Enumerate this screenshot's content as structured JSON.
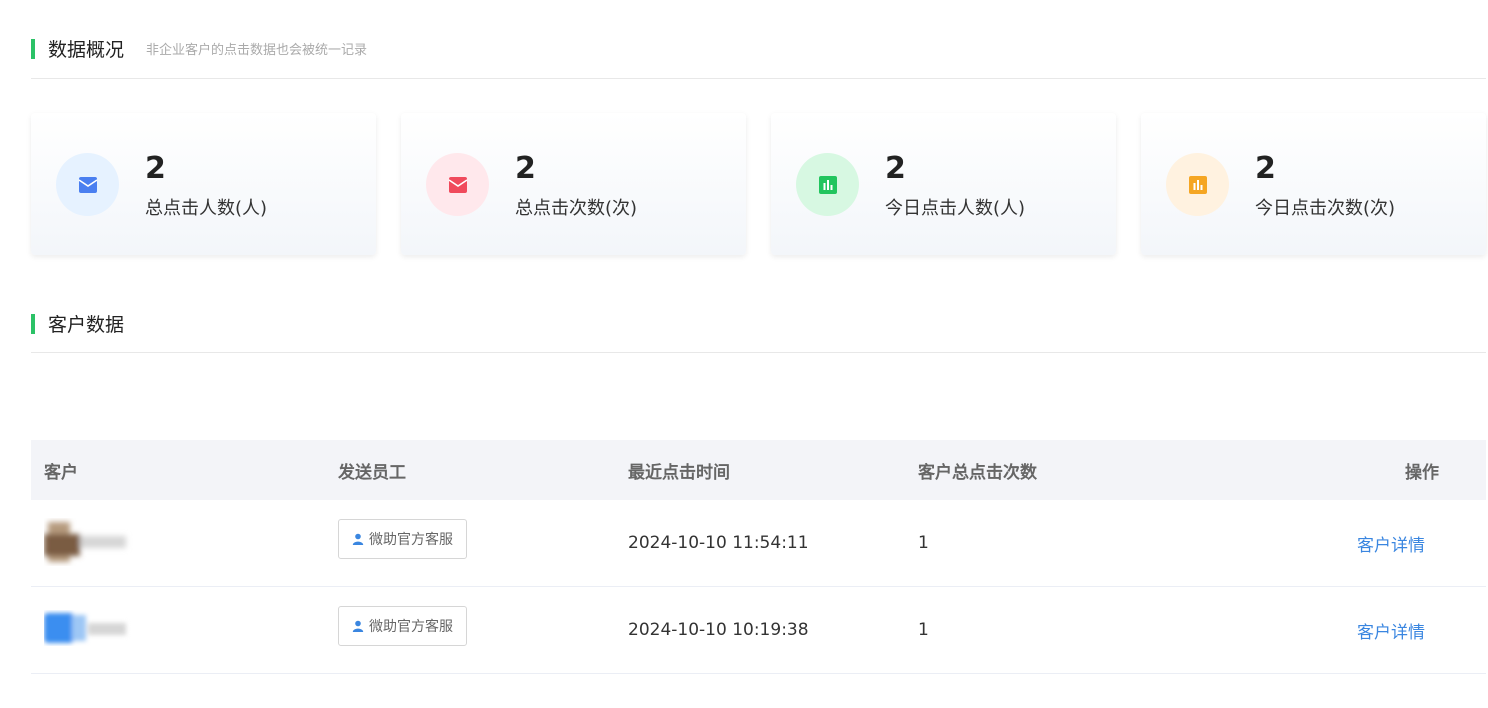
{
  "overview": {
    "title": "数据概况",
    "subtitle": "非企业客户的点击数据也会被统一记录"
  },
  "stats": [
    {
      "value": "2",
      "label": "总点击人数(人)",
      "icon": "envelope-icon",
      "circle_color": "#e6f2ff",
      "icon_color": "#4a7ff0"
    },
    {
      "value": "2",
      "label": "总点击次数(次)",
      "icon": "envelope-icon",
      "circle_color": "#ffe8ec",
      "icon_color": "#f04a5c"
    },
    {
      "value": "2",
      "label": "今日点击人数(人)",
      "icon": "bar-chart-icon",
      "circle_color": "#d7f8e2",
      "icon_color": "#22c55e"
    },
    {
      "value": "2",
      "label": "今日点击次数(次)",
      "icon": "bar-chart-icon",
      "circle_color": "#fff2e0",
      "icon_color": "#f5a623"
    }
  ],
  "customers": {
    "title": "客户数据"
  },
  "table": {
    "headers": [
      "客户",
      "发送员工",
      "最近点击时间",
      "客户总点击次数",
      "操作"
    ],
    "rows": [
      {
        "customer": "",
        "staff": "微助官方客服",
        "last_click": "2024-10-10 11:54:11",
        "count": "1",
        "action": "客户详情"
      },
      {
        "customer": "",
        "staff": "微助官方客服",
        "last_click": "2024-10-10 10:19:38",
        "count": "1",
        "action": "客户详情"
      }
    ]
  },
  "colors": {
    "accent_green": "#2bc267",
    "link_blue": "#3a86e0"
  }
}
